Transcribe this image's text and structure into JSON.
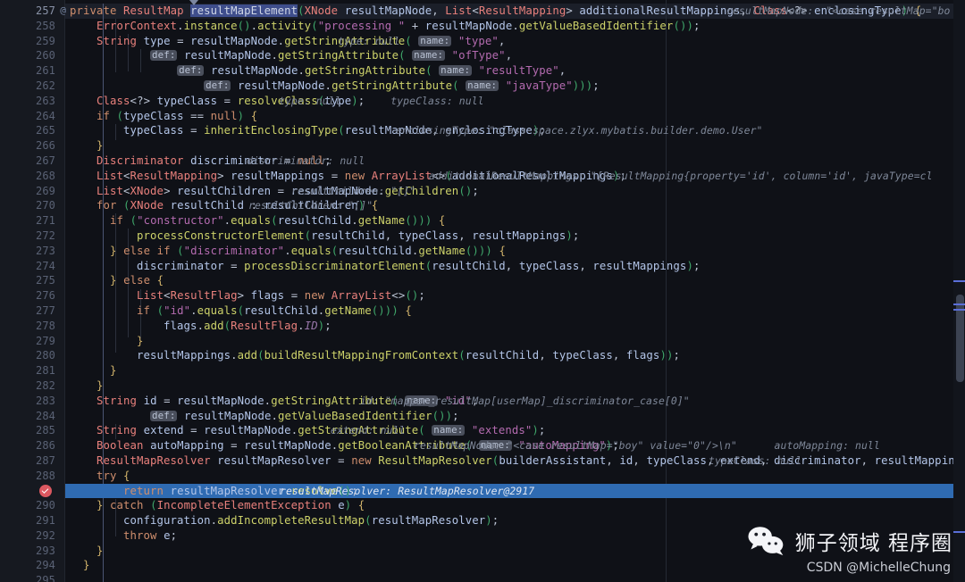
{
  "app": {
    "kind": "java-code-editor-debugger",
    "theme": "dark",
    "colors": {
      "background": "#0f1117",
      "gutter": "#161920",
      "exec_line_highlight": "#2f6bb2",
      "keyword": "#cf8e6d",
      "class_name": "#e8807c",
      "method": "#cdd26a",
      "string": "#b46bb0",
      "identifier": "#b3c5e8",
      "inlay_hint": "#7f8899",
      "selection": "#3f4e8c",
      "breakpoint": "#db5860"
    }
  },
  "gutter": {
    "override_marker_line": "257",
    "override_marker_glyph": "@",
    "breakpoint_line": "289",
    "breakpoint_type": "verified-breakpoint"
  },
  "editor": {
    "first_line_number": 257,
    "last_line_number": 295,
    "selected_symbol": "resultMapElement",
    "executing_line_number": 289,
    "line_numbers": [
      "257",
      "258",
      "259",
      "260",
      "261",
      "262",
      "263",
      "264",
      "265",
      "266",
      "267",
      "268",
      "269",
      "270",
      "271",
      "272",
      "273",
      "274",
      "275",
      "276",
      "277",
      "278",
      "279",
      "280",
      "281",
      "282",
      "283",
      "284",
      "285",
      "286",
      "287",
      "288",
      "289",
      "290",
      "291",
      "292",
      "293",
      "294",
      "295"
    ]
  },
  "code": {
    "lines": [
      {
        "n": "257",
        "text": "private ResultMap resultMapElement(XNode resultMapNode, List<ResultMapping> additionalResultMappings, Class<?> enclosingType) {",
        "hint": "resultMapNode:  \"<case resultMap=\"bo"
      },
      {
        "n": "258",
        "text": "ErrorContext.instance().activity(\"processing \" + resultMapNode.getValueBasedIdentifier());",
        "hint": ""
      },
      {
        "n": "259",
        "text": "String type = resultMapNode.getStringAttribute( name: \"type\",",
        "hint": "type: null"
      },
      {
        "n": "260",
        "text": "def: resultMapNode.getStringAttribute( name: \"ofType\",",
        "hint": ""
      },
      {
        "n": "261",
        "text": "def: resultMapNode.getStringAttribute( name: \"resultType\",",
        "hint": ""
      },
      {
        "n": "262",
        "text": "def: resultMapNode.getStringAttribute( name: \"javaType\")));",
        "hint": ""
      },
      {
        "n": "263",
        "text": "Class<?> typeClass = resolveClass(type);",
        "hint": "type: null        typeClass: null"
      },
      {
        "n": "264",
        "text": "if (typeClass == null) {",
        "hint": ""
      },
      {
        "n": "265",
        "text": "typeClass = inheritEnclosingType(resultMapNode, enclosingType);",
        "hint": "enclosingType: \"class space.zlyx.mybatis.builder.demo.User\""
      },
      {
        "n": "266",
        "text": "}",
        "hint": ""
      },
      {
        "n": "267",
        "text": "Discriminator discriminator = null;",
        "hint": "discriminator: null"
      },
      {
        "n": "268",
        "text": "List<ResultMapping> resultMappings = new ArrayList<>(additionalResultMappings);",
        "hint": "additionalResultMappings: \"[ResultMapping{property='id', column='id', javaType=cl"
      },
      {
        "n": "269",
        "text": "List<XNode> resultChildren = resultMapNode.getChildren();",
        "hint": "resultChildren: \"[]\""
      },
      {
        "n": "270",
        "text": "for (XNode resultChild : resultChildren) {",
        "hint": "resultChildren: \"[]\""
      },
      {
        "n": "271",
        "text": "if (\"constructor\".equals(resultChild.getName())) {",
        "hint": ""
      },
      {
        "n": "272",
        "text": "processConstructorElement(resultChild, typeClass, resultMappings);",
        "hint": ""
      },
      {
        "n": "273",
        "text": "} else if (\"discriminator\".equals(resultChild.getName())) {",
        "hint": ""
      },
      {
        "n": "274",
        "text": "discriminator = processDiscriminatorElement(resultChild, typeClass, resultMappings);",
        "hint": ""
      },
      {
        "n": "275",
        "text": "} else {",
        "hint": ""
      },
      {
        "n": "276",
        "text": "List<ResultFlag> flags = new ArrayList<>();",
        "hint": ""
      },
      {
        "n": "277",
        "text": "if (\"id\".equals(resultChild.getName())) {",
        "hint": ""
      },
      {
        "n": "278",
        "text": "flags.add(ResultFlag.ID);",
        "hint": ""
      },
      {
        "n": "279",
        "text": "}",
        "hint": ""
      },
      {
        "n": "280",
        "text": "resultMappings.add(buildResultMappingFromContext(resultChild, typeClass, flags));",
        "hint": ""
      },
      {
        "n": "281",
        "text": "}",
        "hint": ""
      },
      {
        "n": "282",
        "text": "}",
        "hint": ""
      },
      {
        "n": "283",
        "text": "String id = resultMapNode.getStringAttribute( name: \"id\",",
        "hint": "id: \"mapper_resultMap[userMap]_discriminator_case[0]\""
      },
      {
        "n": "284",
        "text": "def: resultMapNode.getValueBasedIdentifier());",
        "hint": ""
      },
      {
        "n": "285",
        "text": "String extend = resultMapNode.getStringAttribute( name: \"extends\");",
        "hint": "extend: null"
      },
      {
        "n": "286",
        "text": "Boolean autoMapping = resultMapNode.getBooleanAttribute( name: \"autoMapping\");",
        "hint": "resultMapNode: \"<case resultMap=\"boy\" value=\"0\"/>\\n\"      autoMapping: null"
      },
      {
        "n": "287",
        "text": "ResultMapResolver resultMapResolver = new ResultMapResolver(builderAssistant, id, typeClass, extend, discriminator, resultMappings, autoMapping);",
        "hint": "typeClass: null"
      },
      {
        "n": "288",
        "text": "try {",
        "hint": ""
      },
      {
        "n": "289",
        "text": "return resultMapResolver.resolve();",
        "hint": "resultMapResolver: ResultMapResolver@2917"
      },
      {
        "n": "290",
        "text": "} catch (IncompleteElementException e) {",
        "hint": ""
      },
      {
        "n": "291",
        "text": "configuration.addIncompleteResultMap(resultMapResolver);",
        "hint": ""
      },
      {
        "n": "292",
        "text": "throw e;",
        "hint": ""
      },
      {
        "n": "293",
        "text": "}",
        "hint": ""
      },
      {
        "n": "294",
        "text": "}",
        "hint": ""
      },
      {
        "n": "295",
        "text": "",
        "hint": ""
      }
    ],
    "inlay_param_badges": [
      "name:",
      "def:"
    ]
  },
  "watermark": {
    "logo": "wechat-icon",
    "title": "狮子领域 程序圈",
    "subtitle": "CSDN @MichelleChung"
  },
  "scrollbar": {
    "markers": [
      "#5b6fd8",
      "#5b6fd8",
      "#5b6fd8",
      "#5b6fd8"
    ]
  }
}
